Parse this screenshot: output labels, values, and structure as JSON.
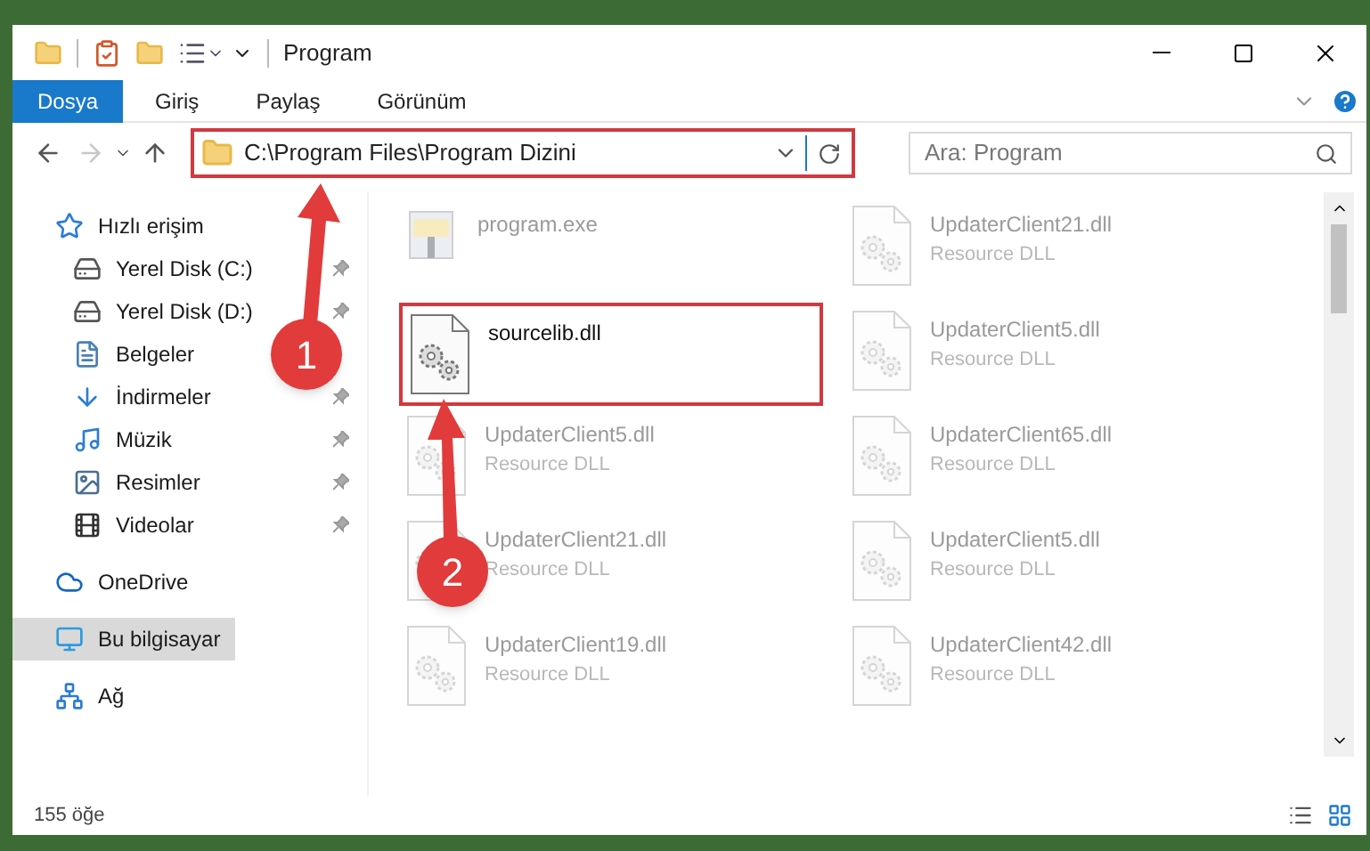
{
  "window": {
    "title": "Program"
  },
  "ribbon_tabs": [
    {
      "label": "Dosya",
      "selected": true
    },
    {
      "label": "Giriş",
      "selected": false
    },
    {
      "label": "Paylaş",
      "selected": false
    },
    {
      "label": "Görünüm",
      "selected": false
    }
  ],
  "nav_buttons": [
    {
      "kind": "back",
      "disabled": false
    },
    {
      "kind": "forward",
      "disabled": true
    },
    {
      "kind": "recent",
      "disabled": false
    },
    {
      "kind": "up",
      "disabled": false
    }
  ],
  "address_bar": {
    "path": "C:\\Program Files\\Program Dizini",
    "highlighted": true
  },
  "search": {
    "placeholder": "Ara: Program"
  },
  "sidebar": {
    "items": [
      {
        "label": "Hızlı erişim",
        "kind": "star",
        "selected": false,
        "children": [
          {
            "label": "Yerel Disk (C:)",
            "kind": "drive",
            "pinned": true,
            "selected": false
          },
          {
            "label": "Yerel Disk (D:)",
            "kind": "drive",
            "pinned": true,
            "selected": false
          },
          {
            "label": "Belgeler",
            "kind": "document",
            "pinned": false,
            "selected": false
          },
          {
            "label": "İndirmeler",
            "kind": "download",
            "pinned": true,
            "selected": false
          },
          {
            "label": "Müzik",
            "kind": "music",
            "pinned": true,
            "selected": false
          },
          {
            "label": "Resimler",
            "kind": "image",
            "pinned": true,
            "selected": false
          },
          {
            "label": "Videolar",
            "kind": "video",
            "pinned": true,
            "selected": false
          }
        ]
      },
      {
        "label": "OneDrive",
        "kind": "cloud",
        "selected": false
      },
      {
        "label": "Bu bilgisayar",
        "kind": "computer",
        "selected": true
      },
      {
        "label": "Ağ",
        "kind": "network",
        "selected": false
      }
    ]
  },
  "files": [
    {
      "name": "program.exe",
      "kind": "exe",
      "faded": true,
      "highlighted": false
    },
    {
      "name": "UpdaterClient21.dll",
      "type": "Resource DLL",
      "kind": "dll",
      "faded": true,
      "highlighted": false
    },
    {
      "name": "sourcelib.dll",
      "kind": "dll",
      "faded": false,
      "highlighted": true
    },
    {
      "name": "UpdaterClient5.dll",
      "type": "Resource DLL",
      "kind": "dll",
      "faded": true,
      "highlighted": false
    },
    {
      "name": "UpdaterClient5.dll",
      "type": "Resource DLL",
      "kind": "dll",
      "faded": true,
      "highlighted": false
    },
    {
      "name": "UpdaterClient65.dll",
      "type": "Resource DLL",
      "kind": "dll",
      "faded": true,
      "highlighted": false
    },
    {
      "name": "UpdaterClient21.dll",
      "type": "Resource DLL",
      "kind": "dll",
      "faded": true,
      "highlighted": false
    },
    {
      "name": "UpdaterClient5.dll",
      "type": "Resource DLL",
      "kind": "dll",
      "faded": true,
      "highlighted": false
    },
    {
      "name": "UpdaterClient19.dll",
      "type": "Resource DLL",
      "kind": "dll",
      "faded": true,
      "highlighted": false
    },
    {
      "name": "UpdaterClient42.dll",
      "type": "Resource DLL",
      "kind": "dll",
      "faded": true,
      "highlighted": false
    }
  ],
  "callouts": [
    {
      "number": "1"
    },
    {
      "number": "2"
    }
  ],
  "status_bar": {
    "item_count": "155 öğe"
  }
}
